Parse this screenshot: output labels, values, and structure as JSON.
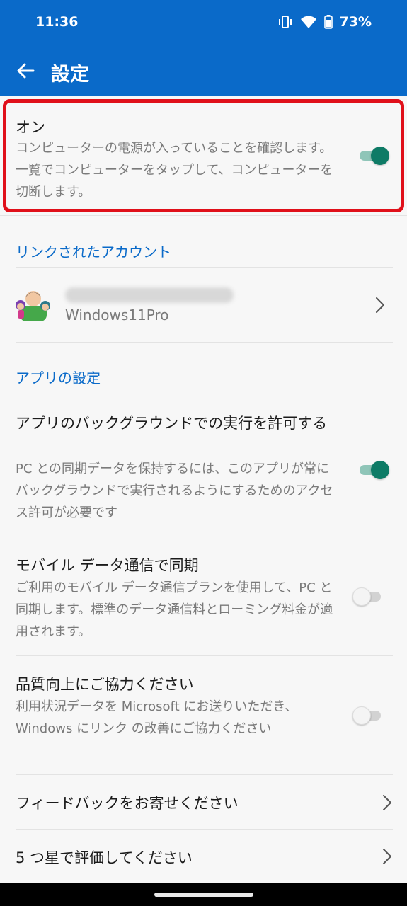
{
  "status_bar": {
    "time": "11:36",
    "battery": "73%",
    "icons": [
      "vibrate-icon",
      "wifi-icon",
      "battery-icon"
    ]
  },
  "app_bar": {
    "title": "設定",
    "back_icon": "arrow-back-icon"
  },
  "main_toggle": {
    "title": "オン",
    "description": "コンピューターの電源が入っていることを確認します。一覧でコンピューターをタップして、コンピューターを切断します。",
    "state": "on",
    "highlight_color": "#e0101a"
  },
  "linked_accounts": {
    "header": "リンクされたアカウント",
    "account": {
      "subtitle": "Windows11Pro"
    }
  },
  "app_settings": {
    "header": "アプリの設定",
    "items": [
      {
        "title": "アプリのバックグラウンドでの実行を許可する",
        "description": "PC との同期データを保持するには、このアプリが常にバックグラウンドで実行されるようにするためのアクセス許可が必要です",
        "state": "on"
      },
      {
        "title": "モバイル データ通信で同期",
        "description": "ご利用のモバイル データ通信プランを使用して、PC と同期します。標準のデータ通信料とローミング料金が適用されます。",
        "state": "off"
      },
      {
        "title": "品質向上にご協力ください",
        "description": "利用状況データを Microsoft にお送りいただき、Windows にリンク の改善にご協力ください",
        "state": "off"
      }
    ]
  },
  "nav_items": [
    {
      "label": "フィードバックをお寄せください"
    },
    {
      "label": "5 つ星で評価してください"
    }
  ],
  "colors": {
    "accent": "#0a6ac9",
    "toggle_on": "#0e7b66",
    "toggle_on_track": "#8fc5b8"
  }
}
